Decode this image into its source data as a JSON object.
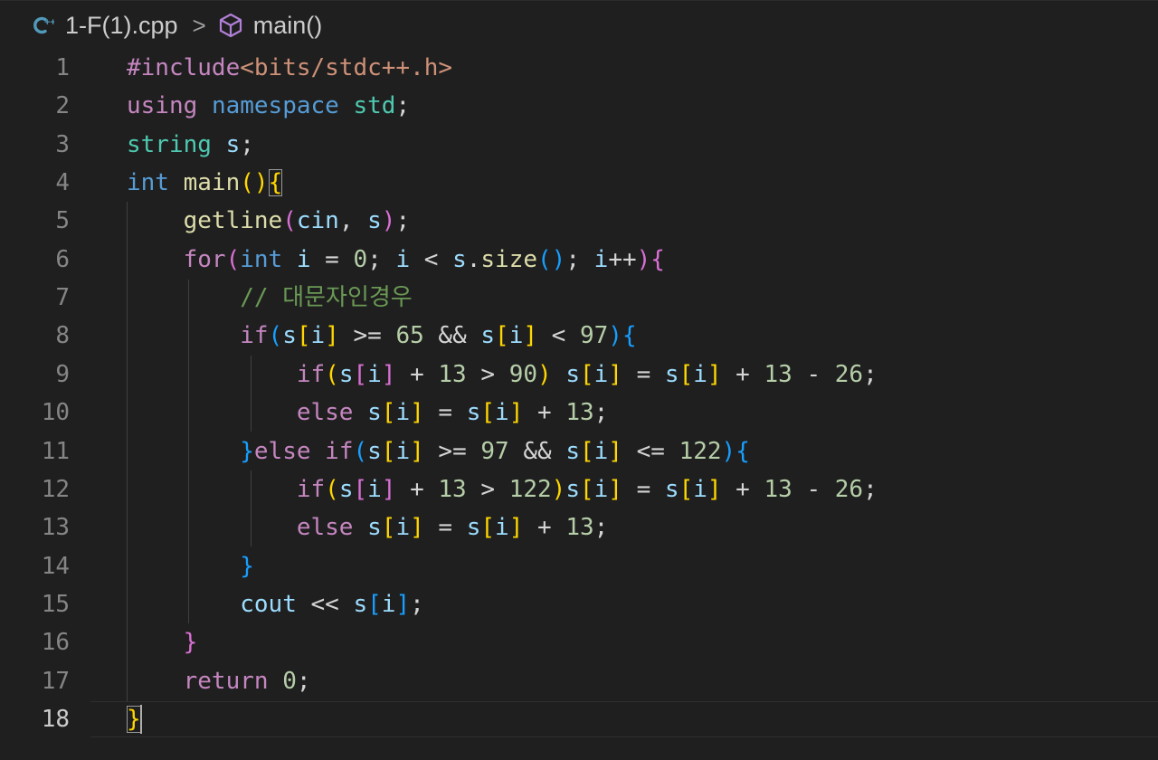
{
  "breadcrumb": {
    "file": "1-F(1).cpp",
    "separator": ">",
    "symbol": "main()",
    "file_icon": "cpp-file-icon",
    "symbol_icon": "cube-symbol-icon"
  },
  "colors": {
    "background": "#1f1f1f",
    "line_number": "#858585",
    "line_number_active": "#cccccc",
    "keyword_control": "#c586c0",
    "keyword_type": "#569cd6",
    "type_name": "#4ec9b0",
    "function": "#dcdcaa",
    "variable": "#9cdcfe",
    "number": "#b5cea8",
    "string": "#ce9178",
    "comment": "#6a9955",
    "bracket_gold": "#ffd700",
    "bracket_purple": "#da70d6",
    "bracket_blue": "#179fff",
    "default": "#d4d4d4"
  },
  "editor": {
    "active_line": 18,
    "lines": [
      {
        "n": "1",
        "tokens": [
          {
            "t": "#include",
            "c": "keyword_control"
          },
          {
            "t": "<bits/stdc++.h>",
            "c": "string"
          }
        ]
      },
      {
        "n": "2",
        "tokens": [
          {
            "t": "using",
            "c": "keyword_control"
          },
          {
            "t": " ",
            "c": "default"
          },
          {
            "t": "namespace",
            "c": "keyword_type"
          },
          {
            "t": " ",
            "c": "default"
          },
          {
            "t": "std",
            "c": "type_name"
          },
          {
            "t": ";",
            "c": "default"
          }
        ]
      },
      {
        "n": "3",
        "tokens": [
          {
            "t": "string",
            "c": "type_name"
          },
          {
            "t": " ",
            "c": "default"
          },
          {
            "t": "s",
            "c": "variable"
          },
          {
            "t": ";",
            "c": "default"
          }
        ]
      },
      {
        "n": "4",
        "tokens": [
          {
            "t": "int",
            "c": "keyword_type"
          },
          {
            "t": " ",
            "c": "default"
          },
          {
            "t": "main",
            "c": "function"
          },
          {
            "t": "()",
            "c": "bracket_gold"
          },
          {
            "t": "{",
            "c": "bracket_gold",
            "box": true
          }
        ]
      },
      {
        "n": "5",
        "tokens": [
          {
            "t": "    ",
            "c": "default"
          },
          {
            "t": "getline",
            "c": "function"
          },
          {
            "t": "(",
            "c": "bracket_purple"
          },
          {
            "t": "cin",
            "c": "variable"
          },
          {
            "t": ", ",
            "c": "default"
          },
          {
            "t": "s",
            "c": "variable"
          },
          {
            "t": ")",
            "c": "bracket_purple"
          },
          {
            "t": ";",
            "c": "default"
          }
        ]
      },
      {
        "n": "6",
        "tokens": [
          {
            "t": "    ",
            "c": "default"
          },
          {
            "t": "for",
            "c": "keyword_control"
          },
          {
            "t": "(",
            "c": "bracket_purple"
          },
          {
            "t": "int",
            "c": "keyword_type"
          },
          {
            "t": " ",
            "c": "default"
          },
          {
            "t": "i",
            "c": "variable"
          },
          {
            "t": " = ",
            "c": "default"
          },
          {
            "t": "0",
            "c": "number"
          },
          {
            "t": "; ",
            "c": "default"
          },
          {
            "t": "i",
            "c": "variable"
          },
          {
            "t": " < ",
            "c": "default"
          },
          {
            "t": "s",
            "c": "variable"
          },
          {
            "t": ".",
            "c": "default"
          },
          {
            "t": "size",
            "c": "function"
          },
          {
            "t": "()",
            "c": "bracket_blue"
          },
          {
            "t": "; ",
            "c": "default"
          },
          {
            "t": "i",
            "c": "variable"
          },
          {
            "t": "++",
            "c": "default"
          },
          {
            "t": ")",
            "c": "bracket_purple"
          },
          {
            "t": "{",
            "c": "bracket_purple"
          }
        ]
      },
      {
        "n": "7",
        "tokens": [
          {
            "t": "        ",
            "c": "default"
          },
          {
            "t": "// 대문자인경우",
            "c": "comment"
          }
        ]
      },
      {
        "n": "8",
        "tokens": [
          {
            "t": "        ",
            "c": "default"
          },
          {
            "t": "if",
            "c": "keyword_control"
          },
          {
            "t": "(",
            "c": "bracket_blue"
          },
          {
            "t": "s",
            "c": "variable"
          },
          {
            "t": "[",
            "c": "bracket_gold"
          },
          {
            "t": "i",
            "c": "variable"
          },
          {
            "t": "]",
            "c": "bracket_gold"
          },
          {
            "t": " >= ",
            "c": "default"
          },
          {
            "t": "65",
            "c": "number"
          },
          {
            "t": " && ",
            "c": "default"
          },
          {
            "t": "s",
            "c": "variable"
          },
          {
            "t": "[",
            "c": "bracket_gold"
          },
          {
            "t": "i",
            "c": "variable"
          },
          {
            "t": "]",
            "c": "bracket_gold"
          },
          {
            "t": " < ",
            "c": "default"
          },
          {
            "t": "97",
            "c": "number"
          },
          {
            "t": ")",
            "c": "bracket_blue"
          },
          {
            "t": "{",
            "c": "bracket_blue"
          }
        ]
      },
      {
        "n": "9",
        "tokens": [
          {
            "t": "            ",
            "c": "default"
          },
          {
            "t": "if",
            "c": "keyword_control"
          },
          {
            "t": "(",
            "c": "bracket_gold"
          },
          {
            "t": "s",
            "c": "variable"
          },
          {
            "t": "[",
            "c": "bracket_purple"
          },
          {
            "t": "i",
            "c": "variable"
          },
          {
            "t": "]",
            "c": "bracket_purple"
          },
          {
            "t": " + ",
            "c": "default"
          },
          {
            "t": "13",
            "c": "number"
          },
          {
            "t": " > ",
            "c": "default"
          },
          {
            "t": "90",
            "c": "number"
          },
          {
            "t": ")",
            "c": "bracket_gold"
          },
          {
            "t": " ",
            "c": "default"
          },
          {
            "t": "s",
            "c": "variable"
          },
          {
            "t": "[",
            "c": "bracket_gold"
          },
          {
            "t": "i",
            "c": "variable"
          },
          {
            "t": "]",
            "c": "bracket_gold"
          },
          {
            "t": " = ",
            "c": "default"
          },
          {
            "t": "s",
            "c": "variable"
          },
          {
            "t": "[",
            "c": "bracket_gold"
          },
          {
            "t": "i",
            "c": "variable"
          },
          {
            "t": "]",
            "c": "bracket_gold"
          },
          {
            "t": " + ",
            "c": "default"
          },
          {
            "t": "13",
            "c": "number"
          },
          {
            "t": " - ",
            "c": "default"
          },
          {
            "t": "26",
            "c": "number"
          },
          {
            "t": ";",
            "c": "default"
          }
        ]
      },
      {
        "n": "10",
        "tokens": [
          {
            "t": "            ",
            "c": "default"
          },
          {
            "t": "else",
            "c": "keyword_control"
          },
          {
            "t": " ",
            "c": "default"
          },
          {
            "t": "s",
            "c": "variable"
          },
          {
            "t": "[",
            "c": "bracket_gold"
          },
          {
            "t": "i",
            "c": "variable"
          },
          {
            "t": "]",
            "c": "bracket_gold"
          },
          {
            "t": " = ",
            "c": "default"
          },
          {
            "t": "s",
            "c": "variable"
          },
          {
            "t": "[",
            "c": "bracket_gold"
          },
          {
            "t": "i",
            "c": "variable"
          },
          {
            "t": "]",
            "c": "bracket_gold"
          },
          {
            "t": " + ",
            "c": "default"
          },
          {
            "t": "13",
            "c": "number"
          },
          {
            "t": ";",
            "c": "default"
          }
        ]
      },
      {
        "n": "11",
        "tokens": [
          {
            "t": "        ",
            "c": "default"
          },
          {
            "t": "}",
            "c": "bracket_blue"
          },
          {
            "t": "else",
            "c": "keyword_control"
          },
          {
            "t": " ",
            "c": "default"
          },
          {
            "t": "if",
            "c": "keyword_control"
          },
          {
            "t": "(",
            "c": "bracket_blue"
          },
          {
            "t": "s",
            "c": "variable"
          },
          {
            "t": "[",
            "c": "bracket_gold"
          },
          {
            "t": "i",
            "c": "variable"
          },
          {
            "t": "]",
            "c": "bracket_gold"
          },
          {
            "t": " >= ",
            "c": "default"
          },
          {
            "t": "97",
            "c": "number"
          },
          {
            "t": " && ",
            "c": "default"
          },
          {
            "t": "s",
            "c": "variable"
          },
          {
            "t": "[",
            "c": "bracket_gold"
          },
          {
            "t": "i",
            "c": "variable"
          },
          {
            "t": "]",
            "c": "bracket_gold"
          },
          {
            "t": " <= ",
            "c": "default"
          },
          {
            "t": "122",
            "c": "number"
          },
          {
            "t": ")",
            "c": "bracket_blue"
          },
          {
            "t": "{",
            "c": "bracket_blue"
          }
        ]
      },
      {
        "n": "12",
        "tokens": [
          {
            "t": "            ",
            "c": "default"
          },
          {
            "t": "if",
            "c": "keyword_control"
          },
          {
            "t": "(",
            "c": "bracket_gold"
          },
          {
            "t": "s",
            "c": "variable"
          },
          {
            "t": "[",
            "c": "bracket_purple"
          },
          {
            "t": "i",
            "c": "variable"
          },
          {
            "t": "]",
            "c": "bracket_purple"
          },
          {
            "t": " + ",
            "c": "default"
          },
          {
            "t": "13",
            "c": "number"
          },
          {
            "t": " > ",
            "c": "default"
          },
          {
            "t": "122",
            "c": "number"
          },
          {
            "t": ")",
            "c": "bracket_gold"
          },
          {
            "t": "s",
            "c": "variable"
          },
          {
            "t": "[",
            "c": "bracket_gold"
          },
          {
            "t": "i",
            "c": "variable"
          },
          {
            "t": "]",
            "c": "bracket_gold"
          },
          {
            "t": " = ",
            "c": "default"
          },
          {
            "t": "s",
            "c": "variable"
          },
          {
            "t": "[",
            "c": "bracket_gold"
          },
          {
            "t": "i",
            "c": "variable"
          },
          {
            "t": "]",
            "c": "bracket_gold"
          },
          {
            "t": " + ",
            "c": "default"
          },
          {
            "t": "13",
            "c": "number"
          },
          {
            "t": " - ",
            "c": "default"
          },
          {
            "t": "26",
            "c": "number"
          },
          {
            "t": ";",
            "c": "default"
          }
        ]
      },
      {
        "n": "13",
        "tokens": [
          {
            "t": "            ",
            "c": "default"
          },
          {
            "t": "else",
            "c": "keyword_control"
          },
          {
            "t": " ",
            "c": "default"
          },
          {
            "t": "s",
            "c": "variable"
          },
          {
            "t": "[",
            "c": "bracket_gold"
          },
          {
            "t": "i",
            "c": "variable"
          },
          {
            "t": "]",
            "c": "bracket_gold"
          },
          {
            "t": " = ",
            "c": "default"
          },
          {
            "t": "s",
            "c": "variable"
          },
          {
            "t": "[",
            "c": "bracket_gold"
          },
          {
            "t": "i",
            "c": "variable"
          },
          {
            "t": "]",
            "c": "bracket_gold"
          },
          {
            "t": " + ",
            "c": "default"
          },
          {
            "t": "13",
            "c": "number"
          },
          {
            "t": ";",
            "c": "default"
          }
        ]
      },
      {
        "n": "14",
        "tokens": [
          {
            "t": "        ",
            "c": "default"
          },
          {
            "t": "}",
            "c": "bracket_blue"
          }
        ]
      },
      {
        "n": "15",
        "tokens": [
          {
            "t": "        ",
            "c": "default"
          },
          {
            "t": "cout",
            "c": "variable"
          },
          {
            "t": " << ",
            "c": "default"
          },
          {
            "t": "s",
            "c": "variable"
          },
          {
            "t": "[",
            "c": "bracket_blue"
          },
          {
            "t": "i",
            "c": "variable"
          },
          {
            "t": "]",
            "c": "bracket_blue"
          },
          {
            "t": ";",
            "c": "default"
          }
        ]
      },
      {
        "n": "16",
        "tokens": [
          {
            "t": "    ",
            "c": "default"
          },
          {
            "t": "}",
            "c": "bracket_purple"
          }
        ]
      },
      {
        "n": "17",
        "tokens": [
          {
            "t": "    ",
            "c": "default"
          },
          {
            "t": "return",
            "c": "keyword_control"
          },
          {
            "t": " ",
            "c": "default"
          },
          {
            "t": "0",
            "c": "number"
          },
          {
            "t": ";",
            "c": "default"
          }
        ]
      },
      {
        "n": "18",
        "tokens": [
          {
            "t": "}",
            "c": "bracket_gold",
            "box": true
          }
        ]
      }
    ]
  }
}
